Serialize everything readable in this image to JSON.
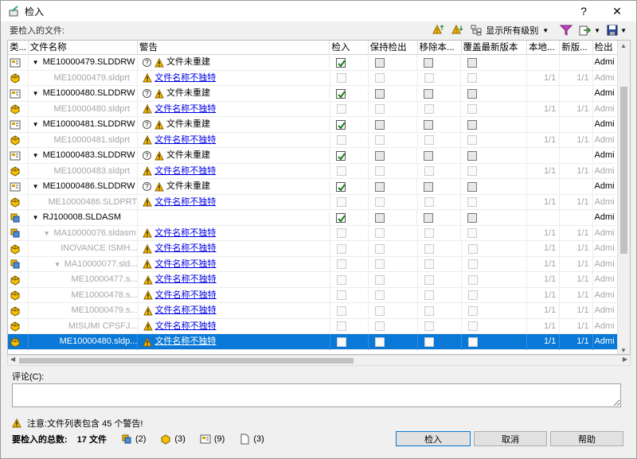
{
  "window": {
    "title": "检入",
    "help": "?",
    "close": "✕"
  },
  "toolbar": {
    "label": "要检入的文件:",
    "show_levels": "显示所有级别"
  },
  "columns": [
    "类...",
    "文件名称",
    "警告",
    "检入",
    "保持检出",
    "移除本...",
    "覆盖最新版本",
    "本地...",
    "新版...",
    "检出"
  ],
  "rows": [
    {
      "type": "drw",
      "indent": 0,
      "expand": true,
      "name": "ME10000479.SLDDRW",
      "gray": false,
      "warn_q": true,
      "warning": "文件未重建",
      "warn_link": false,
      "checked": true,
      "local": "",
      "newv": "",
      "owner": "Admi"
    },
    {
      "type": "prt",
      "indent": 1,
      "expand": false,
      "name": "ME10000479.sldprt",
      "gray": true,
      "warn_q": false,
      "warning": "文件名称不独特",
      "warn_link": true,
      "checked": false,
      "local": "1/1",
      "newv": "1/1",
      "owner": "Admi"
    },
    {
      "type": "drw",
      "indent": 0,
      "expand": true,
      "name": "ME10000480.SLDDRW",
      "gray": false,
      "warn_q": true,
      "warning": "文件未重建",
      "warn_link": false,
      "checked": true,
      "local": "",
      "newv": "",
      "owner": "Admi"
    },
    {
      "type": "prt",
      "indent": 1,
      "expand": false,
      "name": "ME10000480.sldprt",
      "gray": true,
      "warn_q": false,
      "warning": "文件名称不独特",
      "warn_link": true,
      "checked": false,
      "local": "1/1",
      "newv": "1/1",
      "owner": "Admi"
    },
    {
      "type": "drw",
      "indent": 0,
      "expand": true,
      "name": "ME10000481.SLDDRW",
      "gray": false,
      "warn_q": true,
      "warning": "文件未重建",
      "warn_link": false,
      "checked": true,
      "local": "",
      "newv": "",
      "owner": "Admi"
    },
    {
      "type": "prt",
      "indent": 1,
      "expand": false,
      "name": "ME10000481.sldprt",
      "gray": true,
      "warn_q": false,
      "warning": "文件名称不独特",
      "warn_link": true,
      "checked": false,
      "local": "1/1",
      "newv": "1/1",
      "owner": "Admi"
    },
    {
      "type": "drw",
      "indent": 0,
      "expand": true,
      "name": "ME10000483.SLDDRW",
      "gray": false,
      "warn_q": true,
      "warning": "文件未重建",
      "warn_link": false,
      "checked": true,
      "local": "",
      "newv": "",
      "owner": "Admi"
    },
    {
      "type": "prt",
      "indent": 1,
      "expand": false,
      "name": "ME10000483.sldprt",
      "gray": true,
      "warn_q": false,
      "warning": "文件名称不独特",
      "warn_link": true,
      "checked": false,
      "local": "1/1",
      "newv": "1/1",
      "owner": "Admi"
    },
    {
      "type": "drw",
      "indent": 0,
      "expand": true,
      "name": "ME10000486.SLDDRW",
      "gray": false,
      "warn_q": true,
      "warning": "文件未重建",
      "warn_link": false,
      "checked": true,
      "local": "",
      "newv": "",
      "owner": "Admi"
    },
    {
      "type": "prt",
      "indent": 1,
      "expand": false,
      "name": "ME10000486.SLDPRT",
      "gray": true,
      "warn_q": false,
      "warning": "文件名称不独特",
      "warn_link": true,
      "checked": false,
      "local": "1/1",
      "newv": "1/1",
      "owner": "Admi"
    },
    {
      "type": "asm",
      "indent": 0,
      "expand": true,
      "name": "RJ100008.SLDASM",
      "gray": false,
      "warn_q": false,
      "warning": "",
      "warn_link": false,
      "checked": true,
      "local": "",
      "newv": "",
      "owner": "Admi"
    },
    {
      "type": "asm",
      "indent": 1,
      "expand": true,
      "name": "MA10000076.sldasm",
      "gray": true,
      "warn_q": false,
      "warning": "文件名称不独特",
      "warn_link": true,
      "checked": false,
      "local": "1/1",
      "newv": "1/1",
      "owner": "Admi"
    },
    {
      "type": "prt",
      "indent": 2,
      "expand": false,
      "name": "INOVANCE ISMH...",
      "gray": true,
      "warn_q": false,
      "warning": "文件名称不独特",
      "warn_link": true,
      "checked": false,
      "local": "1/1",
      "newv": "1/1",
      "owner": "Admi"
    },
    {
      "type": "asm",
      "indent": 2,
      "expand": true,
      "name": "MA10000077.sld...",
      "gray": true,
      "warn_q": false,
      "warning": "文件名称不独特",
      "warn_link": true,
      "checked": false,
      "local": "1/1",
      "newv": "1/1",
      "owner": "Admi"
    },
    {
      "type": "prt",
      "indent": 3,
      "expand": false,
      "name": "ME10000477.s...",
      "gray": true,
      "warn_q": false,
      "warning": "文件名称不独特",
      "warn_link": true,
      "checked": false,
      "local": "1/1",
      "newv": "1/1",
      "owner": "Admi"
    },
    {
      "type": "prt",
      "indent": 3,
      "expand": false,
      "name": "ME10000478.s...",
      "gray": true,
      "warn_q": false,
      "warning": "文件名称不独特",
      "warn_link": true,
      "checked": false,
      "local": "1/1",
      "newv": "1/1",
      "owner": "Admi"
    },
    {
      "type": "prt",
      "indent": 3,
      "expand": false,
      "name": "ME10000479.s...",
      "gray": true,
      "warn_q": false,
      "warning": "文件名称不独特",
      "warn_link": true,
      "checked": false,
      "local": "1/1",
      "newv": "1/1",
      "owner": "Admi"
    },
    {
      "type": "prt",
      "indent": 3,
      "expand": false,
      "name": "MISUMI CPSFJ...",
      "gray": true,
      "warn_q": false,
      "warning": "文件名称不独特",
      "warn_link": true,
      "checked": false,
      "local": "1/1",
      "newv": "1/1",
      "owner": "Admi"
    },
    {
      "type": "prt",
      "indent": 2,
      "expand": false,
      "name": "ME10000480.sldp...",
      "gray": false,
      "selected": true,
      "warn_q": false,
      "warning": "文件名称不独特",
      "warn_link": true,
      "checked": false,
      "local": "1/1",
      "newv": "1/1",
      "owner": "Admi"
    }
  ],
  "comment": {
    "label": "评论(C):",
    "value": ""
  },
  "note": "注意:文件列表包含 45 个警告!",
  "totals": {
    "label": "要检入的总数:",
    "files": "17 文件",
    "asm": "(2)",
    "prt": "(3)",
    "drw": "(9)",
    "other": "(3)"
  },
  "buttons": {
    "checkin": "检入",
    "cancel": "取消",
    "help": "帮助"
  },
  "colors": {
    "selection": "#0a78d7",
    "link": "#0000e6",
    "warn": "#f5b800"
  }
}
